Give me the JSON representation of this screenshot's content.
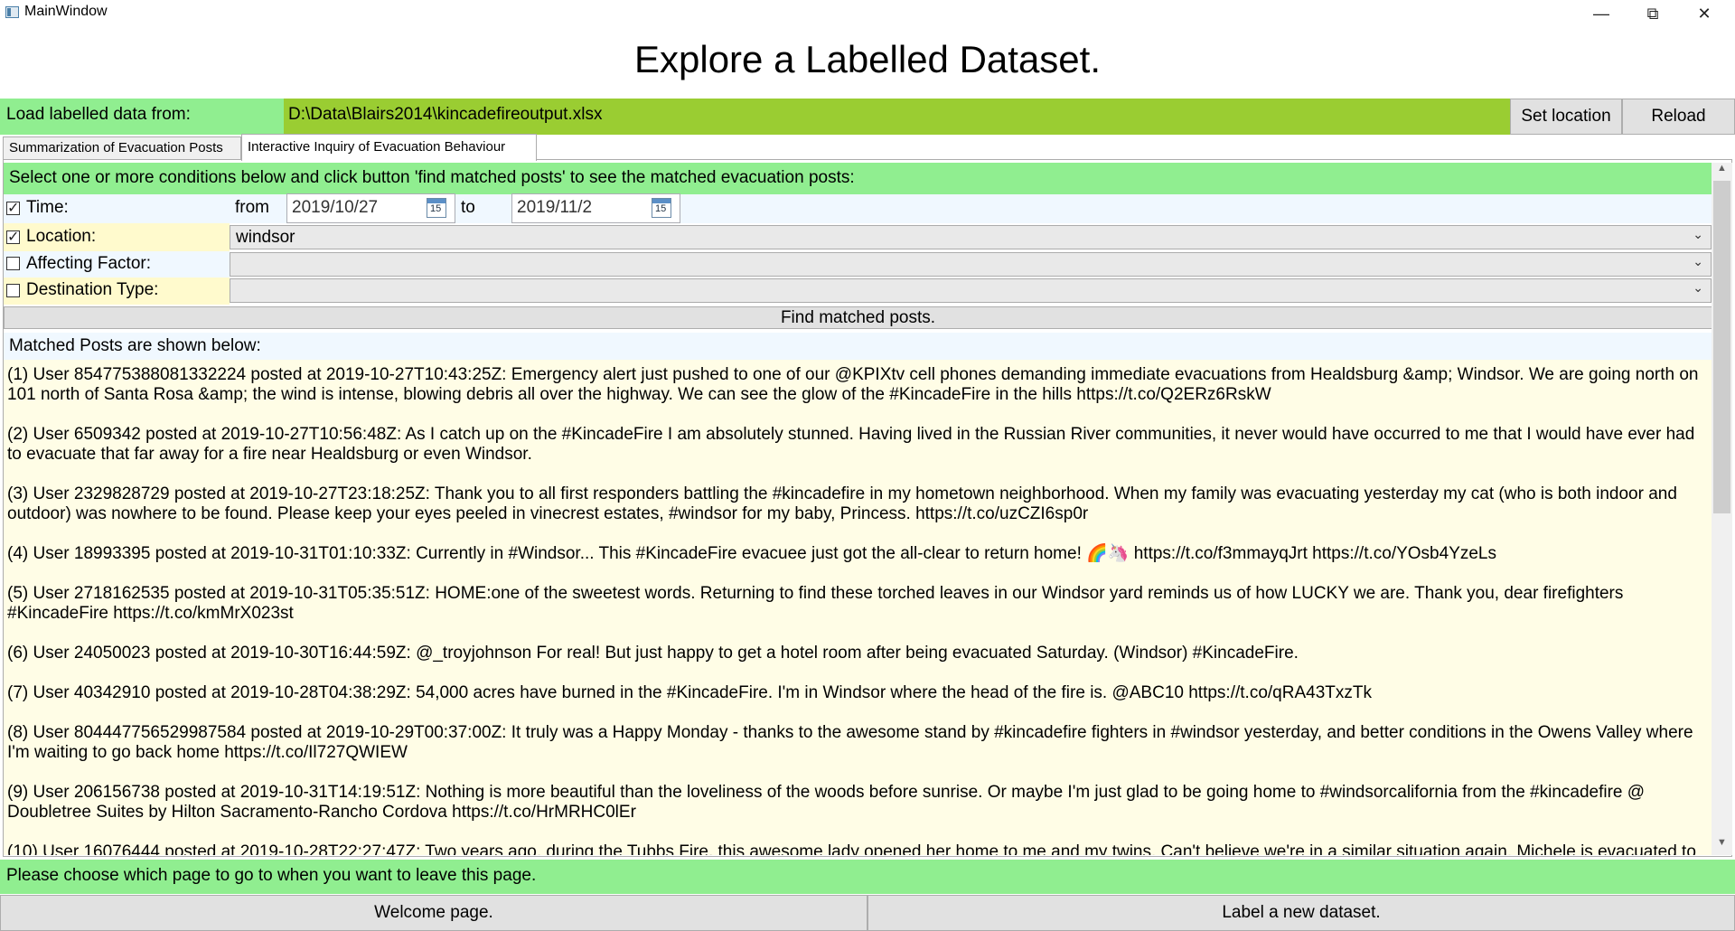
{
  "window": {
    "title": "MainWindow"
  },
  "app_title": "Explore a Labelled Dataset.",
  "load": {
    "label": "Load labelled data from:",
    "path": "D:\\Data\\Blairs2014\\kincadefireoutput.xlsx",
    "set_location": "Set location",
    "reload": "Reload"
  },
  "tabs": [
    {
      "label": "Summarization of Evacuation Posts",
      "selected": false
    },
    {
      "label": "Interactive Inquiry of Evacuation Behaviour",
      "selected": true
    }
  ],
  "instruction": "Select one or more conditions below and click button 'find matched posts' to see the matched evacuation posts:",
  "filters": {
    "time": {
      "label": "Time:",
      "checked": true,
      "from_label": "from",
      "from": "2019/10/27",
      "to_label": "to",
      "to": "2019/11/2",
      "calendar_glyph": "15"
    },
    "location": {
      "label": "Location:",
      "checked": true,
      "value": "windsor"
    },
    "affecting_factor": {
      "label": "Affecting Factor:",
      "checked": false,
      "value": ""
    },
    "destination_type": {
      "label": "Destination Type:",
      "checked": false,
      "value": ""
    }
  },
  "find_button": "Find matched posts.",
  "matched_header": "Matched Posts are shown below:",
  "posts": [
    "(1) User 854775388081332224 posted at 2019-10-27T10:43:25Z: Emergency alert just pushed to one of our @KPIXtv cell phones demanding immediate evacuations from Healdsburg &amp; Windsor. We are going north on 101 north of Santa Rosa &amp; the wind is intense, blowing debris all over the highway. We can see the glow of the #KincadeFire in the hills https://t.co/Q2ERz6RskW",
    "(2) User 6509342 posted at 2019-10-27T10:56:48Z: As I catch up on the #KincadeFire I am absolutely stunned. Having lived in the Russian River communities, it never would have occurred to me that I would have ever had to evacuate that far away for a fire near Healdsburg or even Windsor.",
    "(3) User 2329828729 posted at 2019-10-27T23:18:25Z: Thank you to all first responders battling the #kincadefire in my hometown neighborhood. When my family was evacuating yesterday my cat (who is both indoor and outdoor) was nowhere to be found. Please keep your eyes peeled in vinecrest estates, #windsor for my baby, Princess. https://t.co/uzCZI6sp0r",
    "(4) User 18993395 posted at 2019-10-31T01:10:33Z: Currently in #Windsor... This #KincadeFire evacuee just got the all-clear to return home! 🌈🦄 https://t.co/f3mmayqJrt https://t.co/YOsb4YzeLs",
    "(5) User 2718162535 posted at 2019-10-31T05:35:51Z: HOME:one of the sweetest words. Returning to find these torched leaves in our Windsor yard reminds us of how LUCKY we are. Thank you, dear firefighters  #KincadeFire https://t.co/kmMrX023st",
    "(6) User 24050023 posted at 2019-10-30T16:44:59Z: @_troyjohnson For real! But just happy to get a hotel room after being evacuated Saturday. (Windsor) #KincadeFire.",
    "(7) User 40342910 posted at 2019-10-28T04:38:29Z: 54,000 acres have burned in the #KincadeFire. I'm in Windsor where the head of the fire is. @ABC10 https://t.co/qRA43TxzTk",
    "(8) User 804447756529987584 posted at 2019-10-29T00:37:00Z: It truly was a Happy Monday - thanks to the awesome stand by #kincadefire fighters in #windsor yesterday, and better conditions in the Owens Valley where I'm waiting to go back home https://t.co/Il727QWIEW",
    "(9) User 206156738 posted at 2019-10-31T14:19:51Z: Nothing is more beautiful than the loveliness of the woods before sunrise. Or maybe I'm just glad to be going home to #windsorcalifornia from the #kincadefire @ Doubletree Suites by Hilton Sacramento-Rancho Cordova https://t.co/HrMRHC0lEr",
    "(10) User 16076444 posted at 2019-10-28T22:27:47Z: Two years ago, during the Tubbs Fire, this awesome lady opened her home to me and my twins. Can't believe we're in a similar situation again. Michele is evacuated to"
  ],
  "footer": {
    "note": "Please choose which page to go to when you want to leave this page.",
    "welcome": "Welcome page.",
    "label_new": "Label a new dataset."
  }
}
